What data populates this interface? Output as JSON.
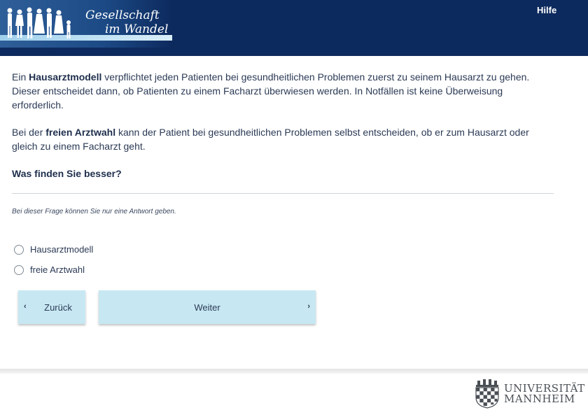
{
  "header": {
    "logo": {
      "line1": "Gesellschaft",
      "line2": "im Wandel"
    },
    "help_label": "Hilfe"
  },
  "intro": {
    "p1_before": "Ein ",
    "p1_bold": "Hausarztmodell",
    "p1_after": " verpflichtet jeden Patienten bei gesundheitlichen Problemen zuerst zu seinem Hausarzt zu gehen. Dieser entscheidet dann, ob Patienten zu einem Facharzt überwiesen werden. In Notfällen ist keine Überweisung erforderlich.",
    "p2_before": "Bei der ",
    "p2_bold": "freien Arztwahl",
    "p2_after": " kann der Patient bei gesundheitlichen Problemen selbst entscheiden, ob er zum Hausarzt oder gleich zu einem Facharzt geht."
  },
  "question": "Was finden Sie besser?",
  "instruction": "Bei dieser Frage können Sie nur eine Antwort geben.",
  "options": [
    {
      "label": "Hausarztmodell"
    },
    {
      "label": "freie Arztwahl"
    }
  ],
  "nav": {
    "back_label": "Zurück",
    "next_label": "Weiter",
    "back_chevron": "‹",
    "next_chevron": "›"
  },
  "footer": {
    "university_line1": "UNIVERSITÄT",
    "university_line2": "MANNHEIM"
  },
  "colors": {
    "header_bg": "#0d2a5e",
    "button_bg": "#c7e8f3",
    "text": "#2b3a55"
  }
}
